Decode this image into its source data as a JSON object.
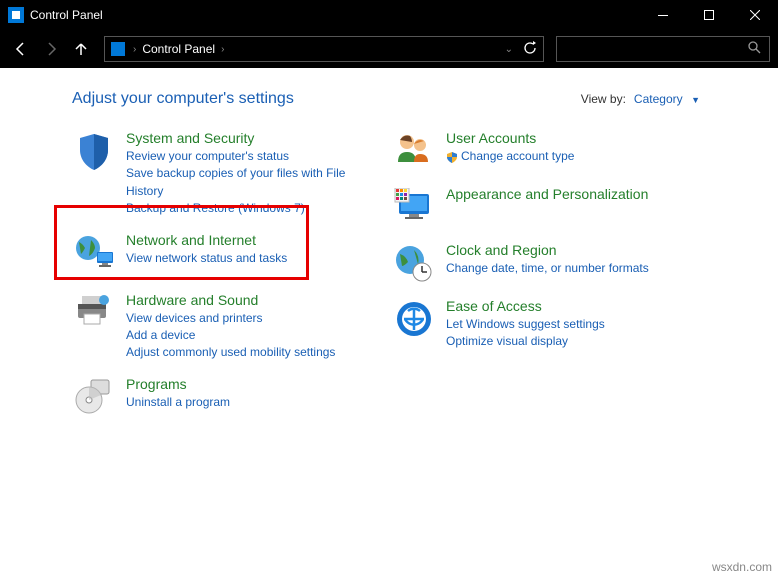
{
  "window": {
    "title": "Control Panel"
  },
  "breadcrumb": {
    "root": "Control Panel"
  },
  "header": {
    "title": "Adjust your computer's settings",
    "viewby_label": "View by:",
    "viewby_value": "Category"
  },
  "left": [
    {
      "title": "System and Security",
      "links": [
        "Review your computer's status",
        "Save backup copies of your files with File History",
        "Backup and Restore (Windows 7)"
      ]
    },
    {
      "title": "Network and Internet",
      "links": [
        "View network status and tasks"
      ]
    },
    {
      "title": "Hardware and Sound",
      "links": [
        "View devices and printers",
        "Add a device",
        "Adjust commonly used mobility settings"
      ]
    },
    {
      "title": "Programs",
      "links": [
        "Uninstall a program"
      ]
    }
  ],
  "right": [
    {
      "title": "User Accounts",
      "links": [
        "Change account type"
      ]
    },
    {
      "title": "Appearance and Personalization",
      "links": []
    },
    {
      "title": "Clock and Region",
      "links": [
        "Change date, time, or number formats"
      ]
    },
    {
      "title": "Ease of Access",
      "links": [
        "Let Windows suggest settings",
        "Optimize visual display"
      ]
    }
  ],
  "watermark": "wsxdn.com"
}
